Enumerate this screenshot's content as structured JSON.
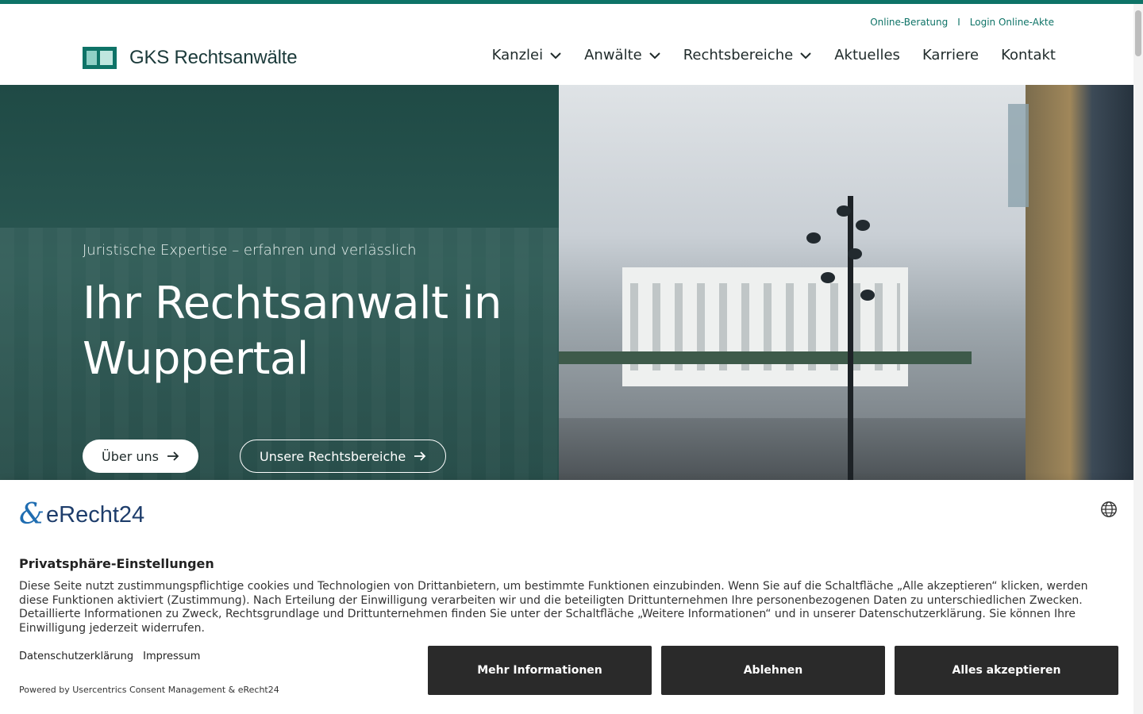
{
  "header": {
    "util_links": {
      "online_beratung": "Online-Beratung",
      "separator": "I",
      "login": "Login Online-Akte"
    },
    "logo_text": "GKS Rechtsanwälte",
    "nav": [
      {
        "label": "Kanzlei",
        "has_dropdown": true
      },
      {
        "label": "Anwälte",
        "has_dropdown": true
      },
      {
        "label": "Rechtsbereiche",
        "has_dropdown": true
      },
      {
        "label": "Aktuelles",
        "has_dropdown": false
      },
      {
        "label": "Karriere",
        "has_dropdown": false
      },
      {
        "label": "Kontakt",
        "has_dropdown": false
      }
    ]
  },
  "hero": {
    "kicker": "Juristische Expertise – erfahren und verlässlich",
    "title": "Ihr Rechtsanwalt in Wuppertal",
    "btn_about": "Über uns",
    "btn_areas": "Unsere Rechtsbereiche"
  },
  "cookie": {
    "logo_mark": "&",
    "logo_text": "eRecht24",
    "title": "Privatsphäre-Einstellungen",
    "text": "Diese Seite nutzt zustimmungspflichtige cookies und Technologien von Drittanbietern, um bestimmte Funktionen einzubinden. Wenn Sie auf die Schaltfläche „Alle akzeptieren“ klicken, werden diese Funktionen aktiviert (Zustimmung). Nach Erteilung der Einwilligung verarbeiten wir und die beteiligten Drittunternehmen Ihre personenbezogenen Daten zu unterschiedlichen Zwecken. Detaillierte Informationen zu Zweck, Rechtsgrundlage und Drittunternehmen finden Sie unter der Schaltfläche „Weitere Informationen“ und in unserer Datenschutzerklärung. Sie können Ihre Einwilligung jederzeit widerrufen.",
    "link_privacy": "Datenschutzerklärung",
    "link_imprint": "Impressum",
    "powered": "Powered by Usercentrics Consent Management & eRecht24",
    "btn_more": "Mehr Informationen",
    "btn_decline": "Ablehnen",
    "btn_accept": "Alles akzeptieren"
  },
  "colors": {
    "brand": "#0e7367",
    "hero_overlay": "#274e4a",
    "cookie_button": "#2a2a2a"
  },
  "icons": [
    "chevron-down-icon",
    "arrow-right-icon",
    "globe-icon",
    "logo-mark-icon"
  ]
}
